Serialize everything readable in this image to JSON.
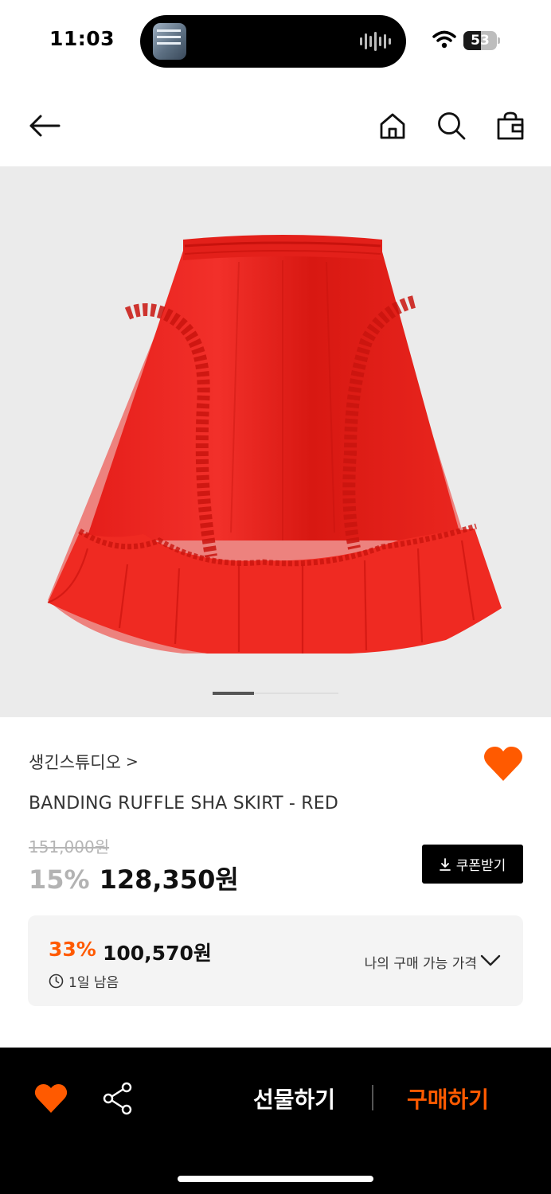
{
  "status_bar": {
    "time": "11:03",
    "battery_percent": "53",
    "battery_level": 0.53,
    "icons": [
      "wifi-icon",
      "battery-icon",
      "audio-waveform-icon"
    ]
  },
  "top_nav": {
    "icons": [
      "back-arrow-icon",
      "home-icon",
      "search-icon",
      "shopping-bag-icon"
    ]
  },
  "gallery": {
    "current_slide_fraction": 0.33
  },
  "product": {
    "brand": "생긴스튜디오",
    "brand_chevron": ">",
    "name": "BANDING RUFFLE SHA SKIRT - RED",
    "original_price": "151,000원",
    "discount_rate": "15%",
    "sale_price": "128,350원",
    "wishlisted": true
  },
  "coupon": {
    "label": "쿠폰받기",
    "icon": "download-icon"
  },
  "member_price": {
    "discount_rate": "33%",
    "price": "100,570원",
    "remaining": "1일 남음",
    "label": "나의 구매 가능 가격",
    "icons": [
      "clock-icon",
      "chevron-down-icon"
    ]
  },
  "bottom_bar": {
    "gift_label": "선물하기",
    "buy_label": "구매하기",
    "icons": [
      "heart-icon",
      "share-icon"
    ]
  },
  "colors": {
    "accent": "#ff5a00",
    "heart": "#ff5a00",
    "bottom_bar_bg": "#000000",
    "product_red": "#e8231e",
    "image_bg": "#ebebeb"
  }
}
